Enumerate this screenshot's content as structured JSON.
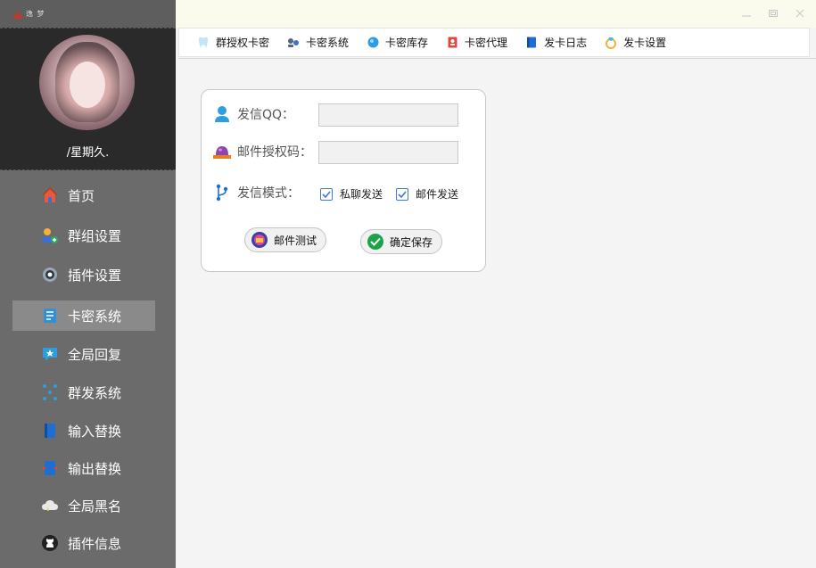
{
  "app": {
    "logo_text": "逸 梦"
  },
  "profile": {
    "username": "/星期久."
  },
  "sidebar": {
    "items": [
      {
        "label": "首页",
        "icon": "home-icon"
      },
      {
        "label": "群组设置",
        "icon": "group-users-icon"
      },
      {
        "label": "插件设置",
        "icon": "gear-icon"
      },
      {
        "label": "卡密系统",
        "icon": "card-list-icon",
        "active": true
      },
      {
        "label": "全局回复",
        "icon": "star-message-icon"
      },
      {
        "label": "群发系统",
        "icon": "broadcast-dots-icon"
      },
      {
        "label": "输入替换",
        "icon": "input-book-icon"
      },
      {
        "label": "输出替换",
        "icon": "output-book-icon"
      },
      {
        "label": "全局黑名",
        "icon": "cloud-blacklist-icon"
      },
      {
        "label": "插件信息",
        "icon": "github-icon"
      }
    ]
  },
  "toolbar": {
    "tabs": [
      {
        "label": "群授权卡密",
        "icon": "tooth-icon"
      },
      {
        "label": "卡密系统",
        "icon": "users-icon"
      },
      {
        "label": "卡密库存",
        "icon": "globe-icon"
      },
      {
        "label": "卡密代理",
        "icon": "agent-doc-icon"
      },
      {
        "label": "发卡日志",
        "icon": "log-book-icon"
      },
      {
        "label": "发卡设置",
        "icon": "ring-icon"
      }
    ]
  },
  "form": {
    "qq_label": "发信QQ：",
    "qq_value": "",
    "auth_label": "邮件授权码：",
    "auth_value": "",
    "mode_label": "发信模式：",
    "options": [
      {
        "label": "私聊发送",
        "checked": true
      },
      {
        "label": "邮件发送",
        "checked": true
      }
    ],
    "test_button": "邮件测试",
    "save_button": "确定保存"
  },
  "colors": {
    "accent": "#3a7bd5",
    "sidebar_bg": "#6b6b6b",
    "profile_bg": "#2a2a2a",
    "save_green": "#1fa14a"
  }
}
